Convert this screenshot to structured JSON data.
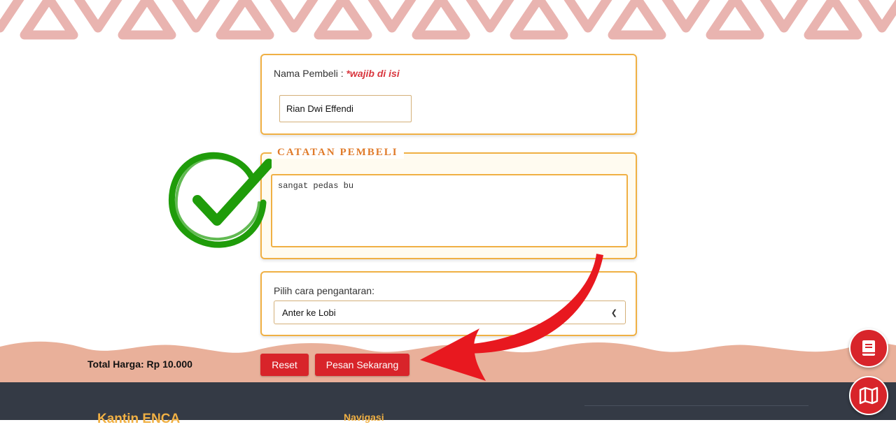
{
  "form": {
    "name_label": "Nama Pembeli : ",
    "name_required": "*wajib di isi",
    "name_value": "Rian Dwi Effendi",
    "notes_legend": "CATATAN PEMBELI",
    "notes_value": "sangat pedas bu",
    "delivery_label": "Pilih cara pengantaran:",
    "delivery_selected": "Anter ke Lobi"
  },
  "summary": {
    "total": "Total Harga: Rp 10.000"
  },
  "buttons": {
    "reset": "Reset",
    "order": "Pesan Sekarang"
  },
  "footer": {
    "brand": "Kantin ENCA",
    "nav_heading": "Navigasi"
  },
  "floating": {
    "book_icon": "book-icon",
    "map_icon": "map-icon"
  },
  "colors": {
    "accent": "#f0b044",
    "primary_button": "#d8242a",
    "footer_bg": "#343a45",
    "legend": "#e07b2a",
    "pattern": "#e9b4b0",
    "check": "#1f9c0a",
    "arrow": "#e8181f"
  }
}
